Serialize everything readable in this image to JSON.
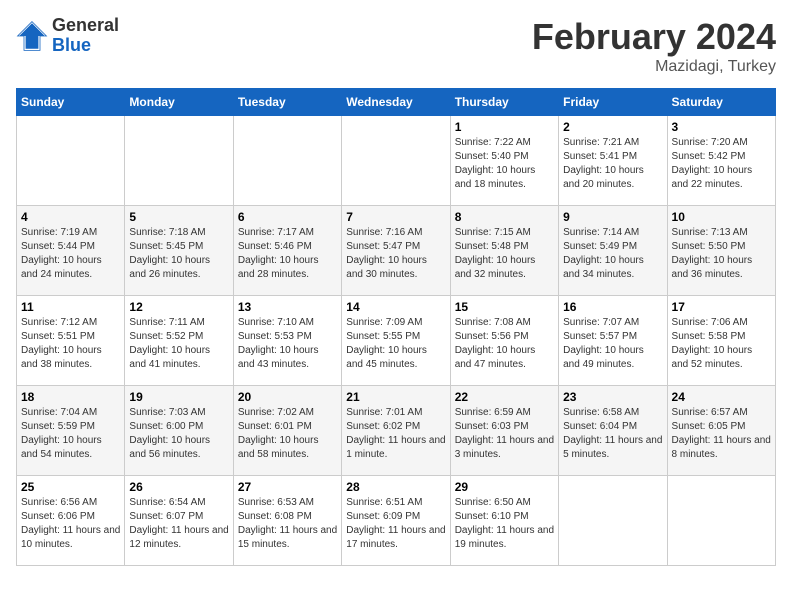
{
  "logo": {
    "general": "General",
    "blue": "Blue"
  },
  "header": {
    "title": "February 2024",
    "subtitle": "Mazidagi, Turkey"
  },
  "weekdays": [
    "Sunday",
    "Monday",
    "Tuesday",
    "Wednesday",
    "Thursday",
    "Friday",
    "Saturday"
  ],
  "weeks": [
    [
      {
        "day": "",
        "sunrise": "",
        "sunset": "",
        "daylight": ""
      },
      {
        "day": "",
        "sunrise": "",
        "sunset": "",
        "daylight": ""
      },
      {
        "day": "",
        "sunrise": "",
        "sunset": "",
        "daylight": ""
      },
      {
        "day": "",
        "sunrise": "",
        "sunset": "",
        "daylight": ""
      },
      {
        "day": "1",
        "sunrise": "Sunrise: 7:22 AM",
        "sunset": "Sunset: 5:40 PM",
        "daylight": "Daylight: 10 hours and 18 minutes."
      },
      {
        "day": "2",
        "sunrise": "Sunrise: 7:21 AM",
        "sunset": "Sunset: 5:41 PM",
        "daylight": "Daylight: 10 hours and 20 minutes."
      },
      {
        "day": "3",
        "sunrise": "Sunrise: 7:20 AM",
        "sunset": "Sunset: 5:42 PM",
        "daylight": "Daylight: 10 hours and 22 minutes."
      }
    ],
    [
      {
        "day": "4",
        "sunrise": "Sunrise: 7:19 AM",
        "sunset": "Sunset: 5:44 PM",
        "daylight": "Daylight: 10 hours and 24 minutes."
      },
      {
        "day": "5",
        "sunrise": "Sunrise: 7:18 AM",
        "sunset": "Sunset: 5:45 PM",
        "daylight": "Daylight: 10 hours and 26 minutes."
      },
      {
        "day": "6",
        "sunrise": "Sunrise: 7:17 AM",
        "sunset": "Sunset: 5:46 PM",
        "daylight": "Daylight: 10 hours and 28 minutes."
      },
      {
        "day": "7",
        "sunrise": "Sunrise: 7:16 AM",
        "sunset": "Sunset: 5:47 PM",
        "daylight": "Daylight: 10 hours and 30 minutes."
      },
      {
        "day": "8",
        "sunrise": "Sunrise: 7:15 AM",
        "sunset": "Sunset: 5:48 PM",
        "daylight": "Daylight: 10 hours and 32 minutes."
      },
      {
        "day": "9",
        "sunrise": "Sunrise: 7:14 AM",
        "sunset": "Sunset: 5:49 PM",
        "daylight": "Daylight: 10 hours and 34 minutes."
      },
      {
        "day": "10",
        "sunrise": "Sunrise: 7:13 AM",
        "sunset": "Sunset: 5:50 PM",
        "daylight": "Daylight: 10 hours and 36 minutes."
      }
    ],
    [
      {
        "day": "11",
        "sunrise": "Sunrise: 7:12 AM",
        "sunset": "Sunset: 5:51 PM",
        "daylight": "Daylight: 10 hours and 38 minutes."
      },
      {
        "day": "12",
        "sunrise": "Sunrise: 7:11 AM",
        "sunset": "Sunset: 5:52 PM",
        "daylight": "Daylight: 10 hours and 41 minutes."
      },
      {
        "day": "13",
        "sunrise": "Sunrise: 7:10 AM",
        "sunset": "Sunset: 5:53 PM",
        "daylight": "Daylight: 10 hours and 43 minutes."
      },
      {
        "day": "14",
        "sunrise": "Sunrise: 7:09 AM",
        "sunset": "Sunset: 5:55 PM",
        "daylight": "Daylight: 10 hours and 45 minutes."
      },
      {
        "day": "15",
        "sunrise": "Sunrise: 7:08 AM",
        "sunset": "Sunset: 5:56 PM",
        "daylight": "Daylight: 10 hours and 47 minutes."
      },
      {
        "day": "16",
        "sunrise": "Sunrise: 7:07 AM",
        "sunset": "Sunset: 5:57 PM",
        "daylight": "Daylight: 10 hours and 49 minutes."
      },
      {
        "day": "17",
        "sunrise": "Sunrise: 7:06 AM",
        "sunset": "Sunset: 5:58 PM",
        "daylight": "Daylight: 10 hours and 52 minutes."
      }
    ],
    [
      {
        "day": "18",
        "sunrise": "Sunrise: 7:04 AM",
        "sunset": "Sunset: 5:59 PM",
        "daylight": "Daylight: 10 hours and 54 minutes."
      },
      {
        "day": "19",
        "sunrise": "Sunrise: 7:03 AM",
        "sunset": "Sunset: 6:00 PM",
        "daylight": "Daylight: 10 hours and 56 minutes."
      },
      {
        "day": "20",
        "sunrise": "Sunrise: 7:02 AM",
        "sunset": "Sunset: 6:01 PM",
        "daylight": "Daylight: 10 hours and 58 minutes."
      },
      {
        "day": "21",
        "sunrise": "Sunrise: 7:01 AM",
        "sunset": "Sunset: 6:02 PM",
        "daylight": "Daylight: 11 hours and 1 minute."
      },
      {
        "day": "22",
        "sunrise": "Sunrise: 6:59 AM",
        "sunset": "Sunset: 6:03 PM",
        "daylight": "Daylight: 11 hours and 3 minutes."
      },
      {
        "day": "23",
        "sunrise": "Sunrise: 6:58 AM",
        "sunset": "Sunset: 6:04 PM",
        "daylight": "Daylight: 11 hours and 5 minutes."
      },
      {
        "day": "24",
        "sunrise": "Sunrise: 6:57 AM",
        "sunset": "Sunset: 6:05 PM",
        "daylight": "Daylight: 11 hours and 8 minutes."
      }
    ],
    [
      {
        "day": "25",
        "sunrise": "Sunrise: 6:56 AM",
        "sunset": "Sunset: 6:06 PM",
        "daylight": "Daylight: 11 hours and 10 minutes."
      },
      {
        "day": "26",
        "sunrise": "Sunrise: 6:54 AM",
        "sunset": "Sunset: 6:07 PM",
        "daylight": "Daylight: 11 hours and 12 minutes."
      },
      {
        "day": "27",
        "sunrise": "Sunrise: 6:53 AM",
        "sunset": "Sunset: 6:08 PM",
        "daylight": "Daylight: 11 hours and 15 minutes."
      },
      {
        "day": "28",
        "sunrise": "Sunrise: 6:51 AM",
        "sunset": "Sunset: 6:09 PM",
        "daylight": "Daylight: 11 hours and 17 minutes."
      },
      {
        "day": "29",
        "sunrise": "Sunrise: 6:50 AM",
        "sunset": "Sunset: 6:10 PM",
        "daylight": "Daylight: 11 hours and 19 minutes."
      },
      {
        "day": "",
        "sunrise": "",
        "sunset": "",
        "daylight": ""
      },
      {
        "day": "",
        "sunrise": "",
        "sunset": "",
        "daylight": ""
      }
    ]
  ]
}
